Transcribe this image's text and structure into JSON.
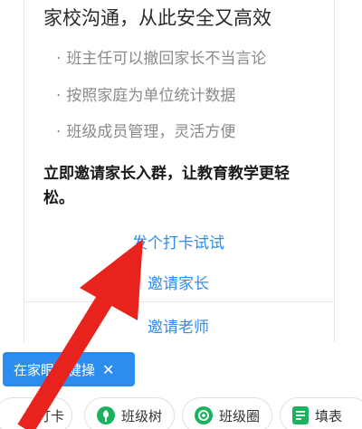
{
  "card": {
    "heading": "家校沟通，从此安全又高效",
    "bullets": [
      "班主任可以撤回家长不当言论",
      "按照家庭为单位统计数据",
      "班级成员管理，灵活方便"
    ],
    "bullet_mark": "·",
    "cta": "立即邀请家长入群，让教育教学更轻松。",
    "actions": {
      "checkin": "发个打卡试试",
      "invite_parents": "邀请家长",
      "invite_teachers": "邀请老师"
    }
  },
  "chip": {
    "label": "在家眼保健操",
    "close": "✕"
  },
  "bottom_bar": {
    "items": [
      {
        "label": "打卡",
        "icon": "checkin-icon"
      },
      {
        "label": "班级树",
        "icon": "tree-icon"
      },
      {
        "label": "班级圈",
        "icon": "circle-icon"
      },
      {
        "label": "填表",
        "icon": "form-icon"
      }
    ]
  },
  "colors": {
    "accent": "#2d8cf0",
    "arrow": "#e8231d",
    "green": "#19b35f"
  }
}
